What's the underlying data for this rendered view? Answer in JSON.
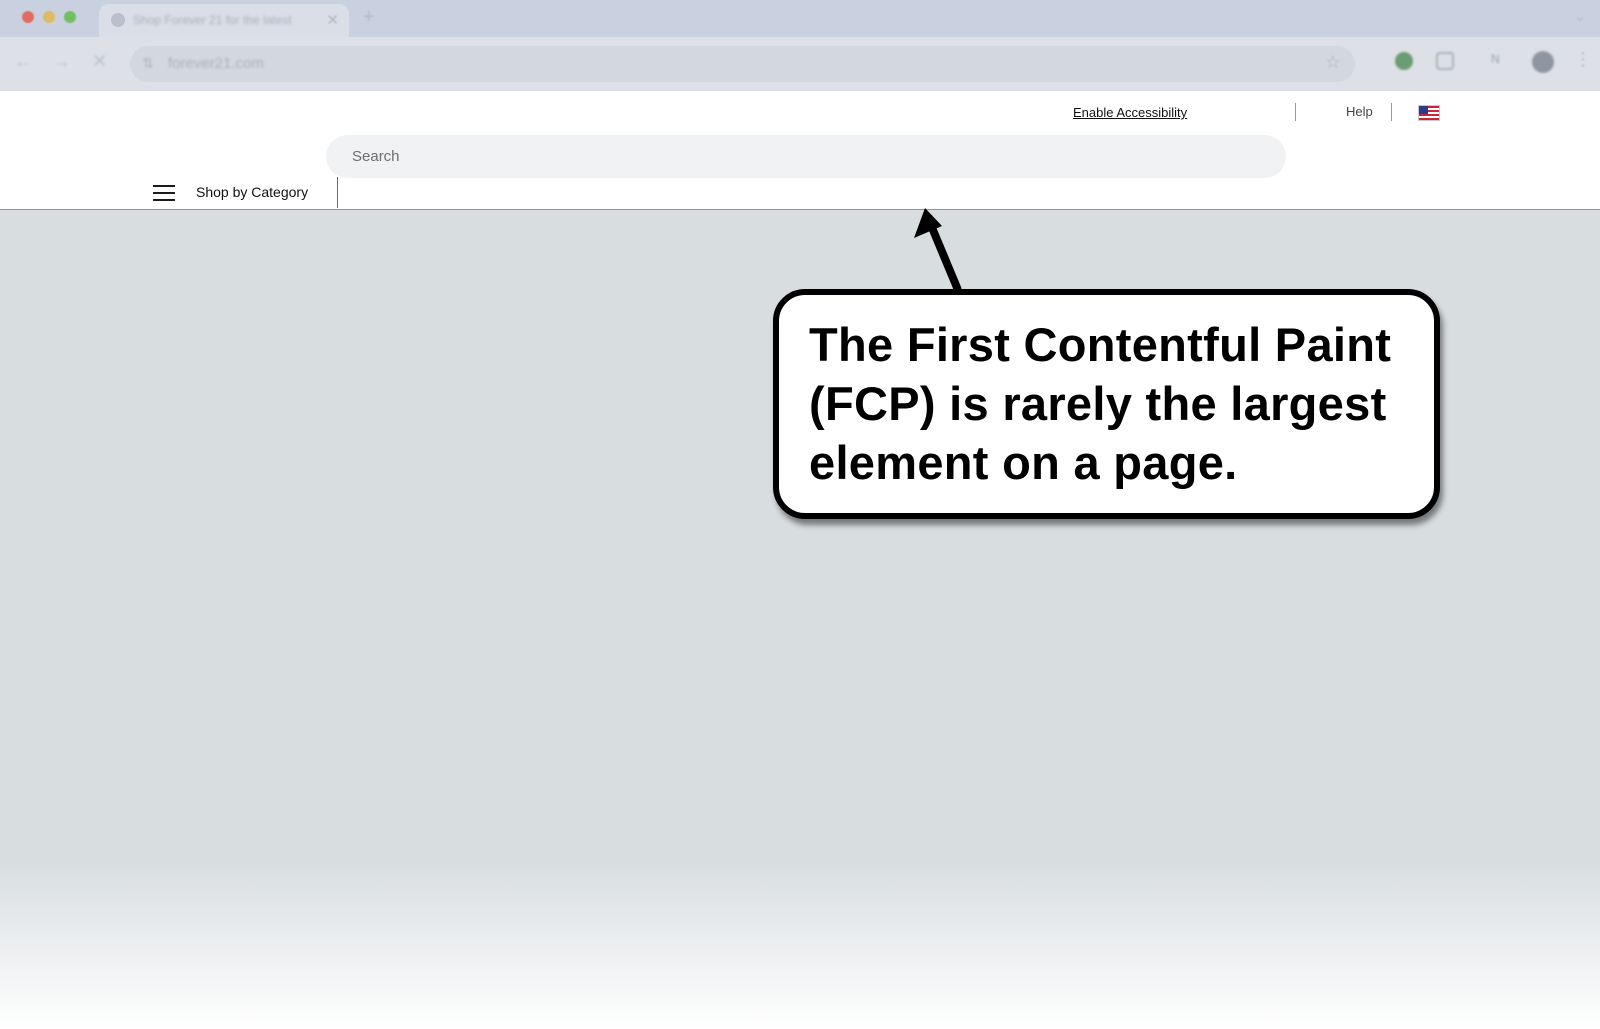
{
  "browser": {
    "tab_title": "Shop Forever 21 for the latest",
    "tab_close": "✕",
    "new_tab": "+",
    "url": "forever21.com"
  },
  "header": {
    "enable_accessibility": "Enable Accessibility",
    "help": "Help",
    "search_placeholder": "Search",
    "shop_by_category": "Shop by Category"
  },
  "annotation": {
    "text": "The First Contentful Paint (FCP) is rarely the largest element on a page."
  },
  "colors": {
    "overlay": "#d8dde0",
    "chrome": "#c9d1e0",
    "callout_border": "#000000"
  }
}
